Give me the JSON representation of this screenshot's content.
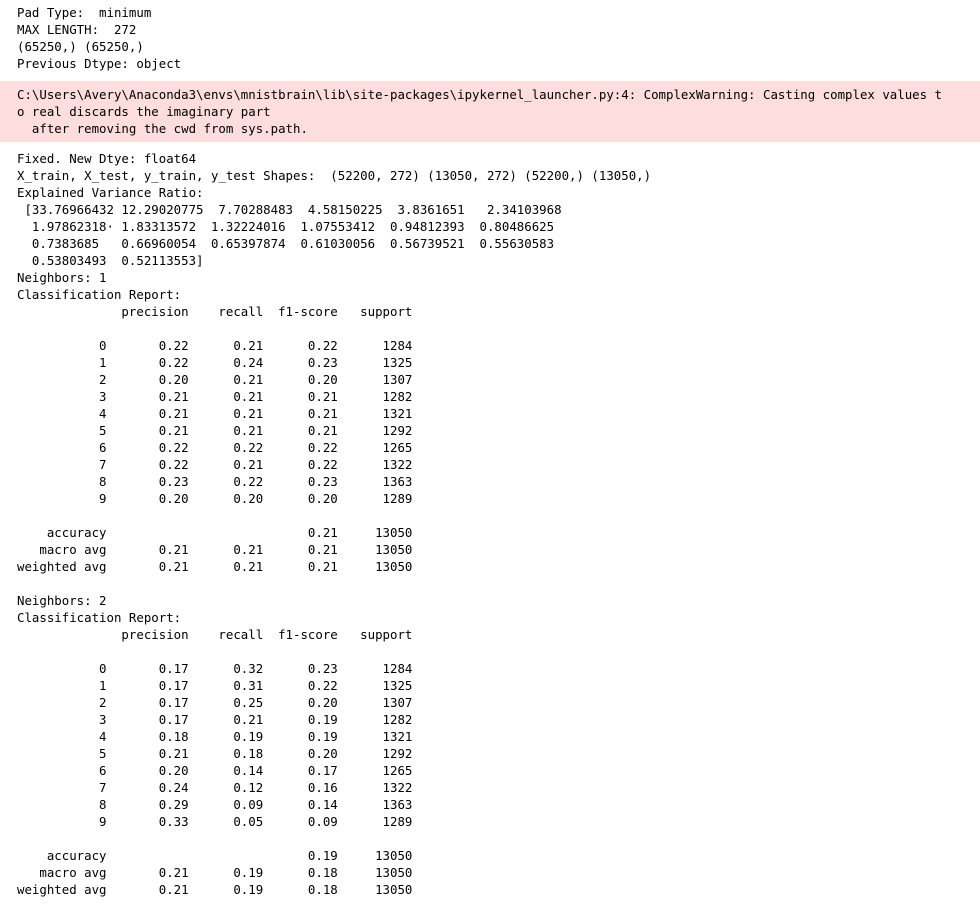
{
  "output_header": {
    "lines": [
      "Pad Type:  minimum",
      "MAX LENGTH:  272",
      "(65250,) (65250,)",
      "Previous Dtype: object"
    ]
  },
  "warning": {
    "lines": [
      "C:\\Users\\Avery\\Anaconda3\\envs\\mnistbrain\\lib\\site-packages\\ipykernel_launcher.py:4: ComplexWarning: Casting complex values t",
      "o real discards the imaginary part",
      "  after removing the cwd from sys.path."
    ],
    "background": "#fddddd"
  },
  "output_body": {
    "lines": [
      "Fixed. New Dtye: float64",
      "X_train, X_test, y_train, y_test Shapes:  (52200, 272) (13050, 272) (52200,) (13050,)",
      "Explained Variance Ratio:",
      " [33.76966432 12.29020775  7.70288483  4.58150225  3.8361651   2.34103968",
      "  1.97862318· 1.83313572  1.32224016  1.07553412  0.94812393  0.80486625",
      "  0.7383685   0.66960054  0.65397874  0.61030056  0.56739521  0.55630583",
      "  0.53803493  0.52113553]",
      "Neighbors: 1",
      "Classification Report:",
      "              precision    recall  f1-score   support",
      "",
      "           0       0.22      0.21      0.22      1284",
      "           1       0.22      0.24      0.23      1325",
      "           2       0.20      0.21      0.20      1307",
      "           3       0.21      0.21      0.21      1282",
      "           4       0.21      0.21      0.21      1321",
      "           5       0.21      0.21      0.21      1292",
      "           6       0.22      0.22      0.22      1265",
      "           7       0.22      0.21      0.22      1322",
      "           8       0.23      0.22      0.23      1363",
      "           9       0.20      0.20      0.20      1289",
      "",
      "    accuracy                           0.21     13050",
      "   macro avg       0.21      0.21      0.21     13050",
      "weighted avg       0.21      0.21      0.21     13050",
      "",
      "Neighbors: 2",
      "Classification Report:",
      "              precision    recall  f1-score   support",
      "",
      "           0       0.17      0.32      0.23      1284",
      "           1       0.17      0.31      0.22      1325",
      "           2       0.17      0.25      0.20      1307",
      "           3       0.17      0.21      0.19      1282",
      "           4       0.18      0.19      0.19      1321",
      "           5       0.21      0.18      0.20      1292",
      "           6       0.20      0.14      0.17      1265",
      "           7       0.24      0.12      0.16      1322",
      "           8       0.29      0.09      0.14      1363",
      "           9       0.33      0.05      0.09      1289",
      "",
      "    accuracy                           0.19     13050",
      "   macro avg       0.21      0.19      0.18     13050",
      "weighted avg       0.21      0.19      0.18     13050"
    ]
  }
}
